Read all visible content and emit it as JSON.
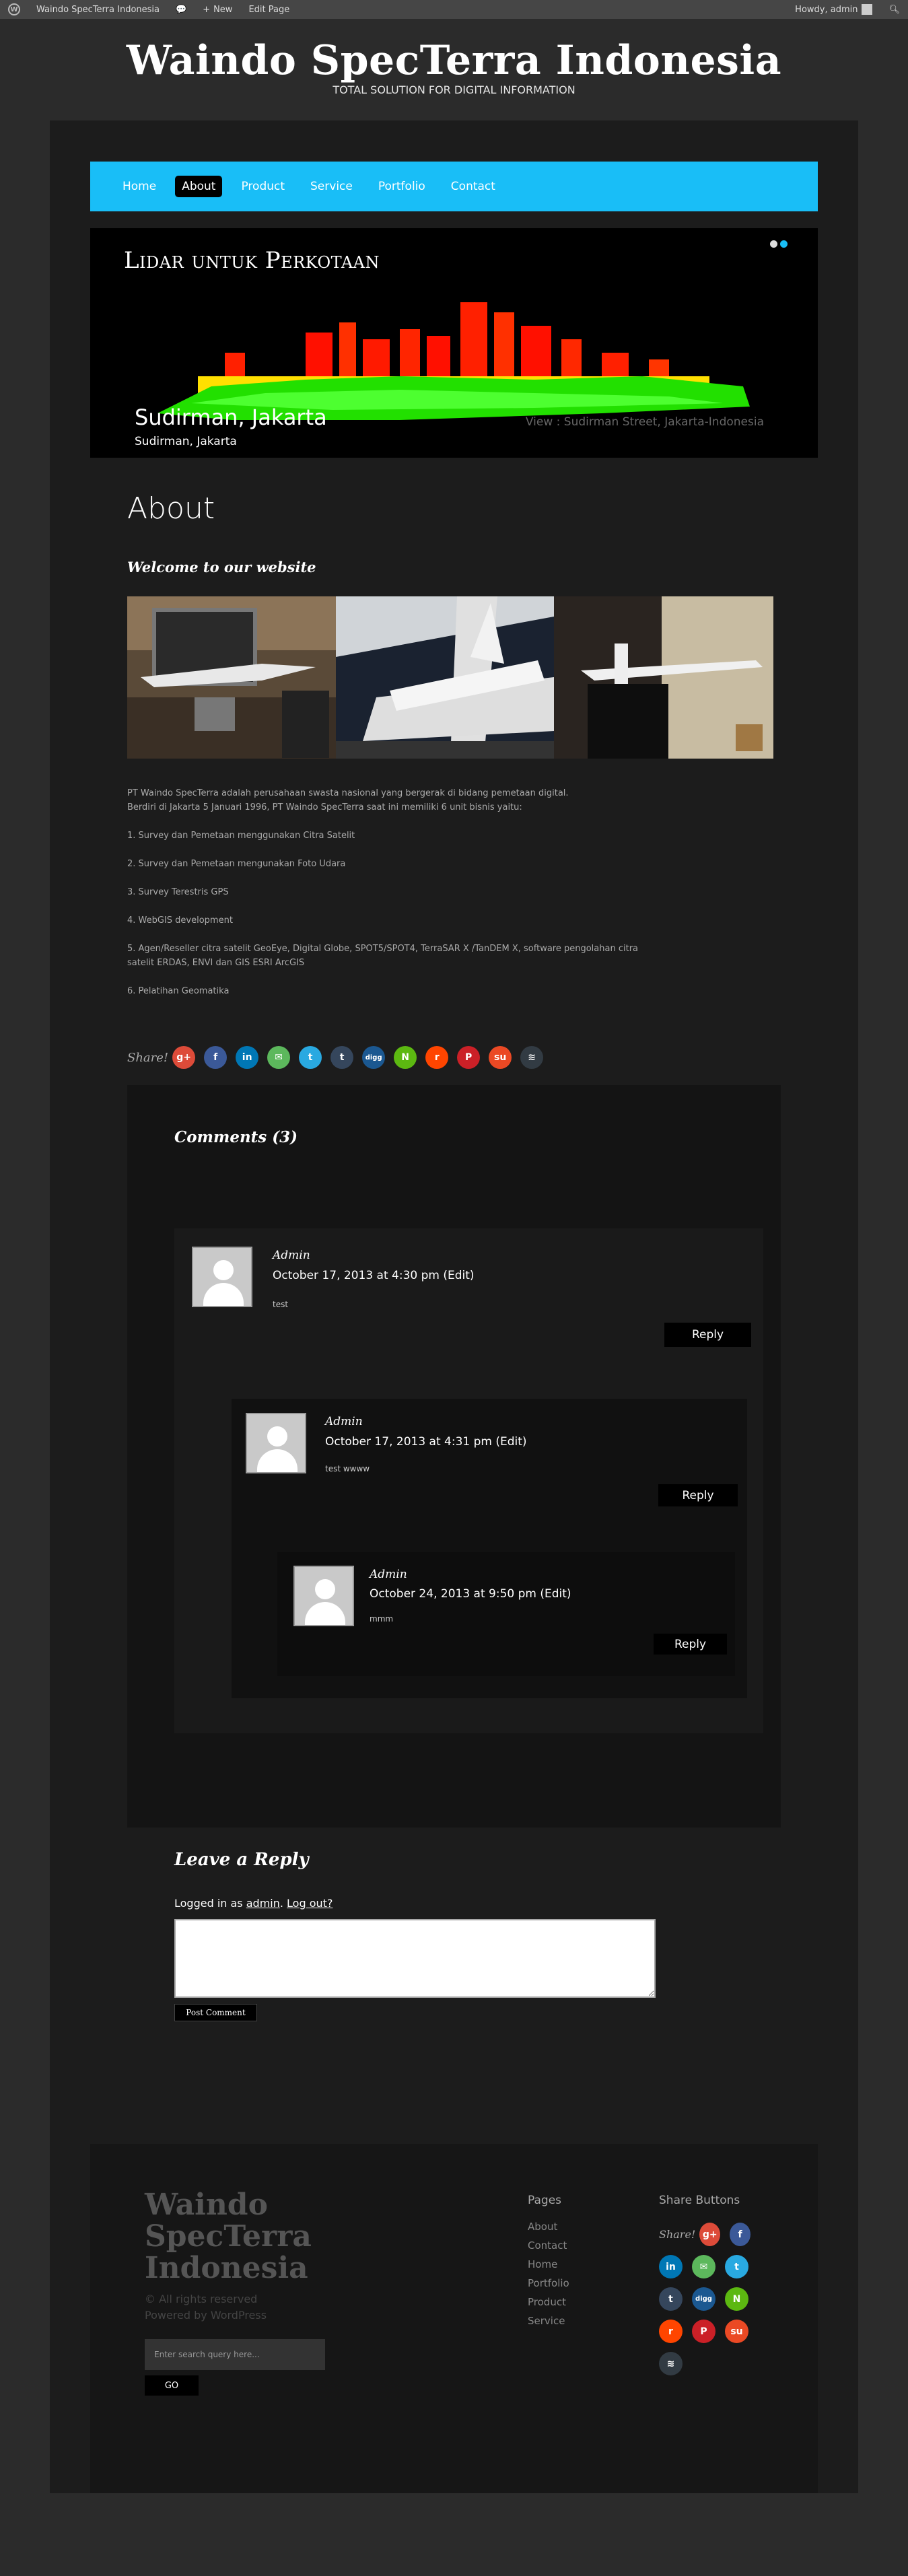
{
  "adminbar": {
    "site_name": "Waindo SpecTerra Indonesia",
    "new_label": "New",
    "edit_label": "Edit Page",
    "howdy": "Howdy, admin"
  },
  "site": {
    "title": "Waindo SpecTerra Indonesia",
    "tagline": "TOTAL SOLUTION FOR DIGITAL INFORMATION"
  },
  "nav": {
    "items": [
      {
        "label": "Home"
      },
      {
        "label": "About"
      },
      {
        "label": "Product"
      },
      {
        "label": "Service"
      },
      {
        "label": "Portfolio"
      },
      {
        "label": "Contact"
      }
    ],
    "active": "About"
  },
  "slider": {
    "heading": "Lidar untuk Perkotaan",
    "view_text": "View : Sudirman Street, Jakarta-Indonesia",
    "caption_title": "Sudirman, Jakarta",
    "caption_sub": "Sudirman, Jakarta"
  },
  "page": {
    "title": "About",
    "welcome": "Welcome to our website",
    "intro_1": "PT Waindo SpecTerra adalah perusahaan swasta nasional yang bergerak di bidang pemetaan digital.",
    "intro_2": "Berdiri di Jakarta 5 Januari 1996, PT Waindo SpecTerra saat ini memiliki 6 unit bisnis yaitu:",
    "items": [
      "1. Survey dan Pemetaan menggunakan Citra Satelit",
      "2. Survey dan Pemetaan mengunakan Foto Udara",
      "3. Survey Terestris GPS",
      "4. WebGIS development",
      "5. Agen/Reseller citra satelit GeoEye, Digital Globe, SPOT5/SPOT4, TerraSAR X /TanDEM X, software pengolahan citra satelit ERDAS, ENVI dan GIS ESRI ArcGIS",
      "6. Pelatihan Geomatika"
    ]
  },
  "share": {
    "label": "Share!",
    "icons": [
      {
        "name": "googleplus-icon",
        "glyph": "g+",
        "color": "#dd4b39"
      },
      {
        "name": "facebook-icon",
        "glyph": "f",
        "color": "#3b5998"
      },
      {
        "name": "linkedin-icon",
        "glyph": "in",
        "color": "#0077b5"
      },
      {
        "name": "email-icon",
        "glyph": "✉",
        "color": "#5cb85c"
      },
      {
        "name": "twitter-icon",
        "glyph": "t",
        "color": "#29a9e1"
      },
      {
        "name": "tumblr-icon",
        "glyph": "t",
        "color": "#35465c"
      },
      {
        "name": "digg-icon",
        "glyph": "digg",
        "color": "#1b5891"
      },
      {
        "name": "newsvine-icon",
        "glyph": "N",
        "color": "#5cb811"
      },
      {
        "name": "reddit-icon",
        "glyph": "r",
        "color": "#ff4500"
      },
      {
        "name": "pinterest-icon",
        "glyph": "P",
        "color": "#cb2027"
      },
      {
        "name": "stumbleupon-icon",
        "glyph": "su",
        "color": "#eb4924"
      },
      {
        "name": "buffer-icon",
        "glyph": "≋",
        "color": "#323b43"
      }
    ]
  },
  "comments": {
    "title": "Comments (3)",
    "list": [
      {
        "author": "Admin",
        "date": "October 17, 2013 at 4:30 pm (Edit)",
        "text": "test",
        "reply": "Reply"
      },
      {
        "author": "Admin",
        "date": "October 17, 2013 at 4:31 pm (Edit)",
        "text": "test wwww",
        "reply": "Reply"
      },
      {
        "author": "Admin",
        "date": "October 24, 2013 at 9:50 pm (Edit)",
        "text": "mmm",
        "reply": "Reply"
      }
    ]
  },
  "reply_form": {
    "title": "Leave a Reply",
    "logged_prefix": "Logged in as",
    "user": "admin",
    "logout": "Log out?",
    "submit": "Post Comment"
  },
  "footer": {
    "title": "Waindo SpecTerra Indonesia",
    "copyright": "© All rights reserved",
    "powered": "Powered by WordPress",
    "search_placeholder": "Enter search query here...",
    "go": "GO",
    "pages_heading": "Pages",
    "pages": [
      "About",
      "Contact",
      "Home",
      "Portfolio",
      "Product",
      "Service"
    ],
    "share_heading": "Share Buttons"
  }
}
